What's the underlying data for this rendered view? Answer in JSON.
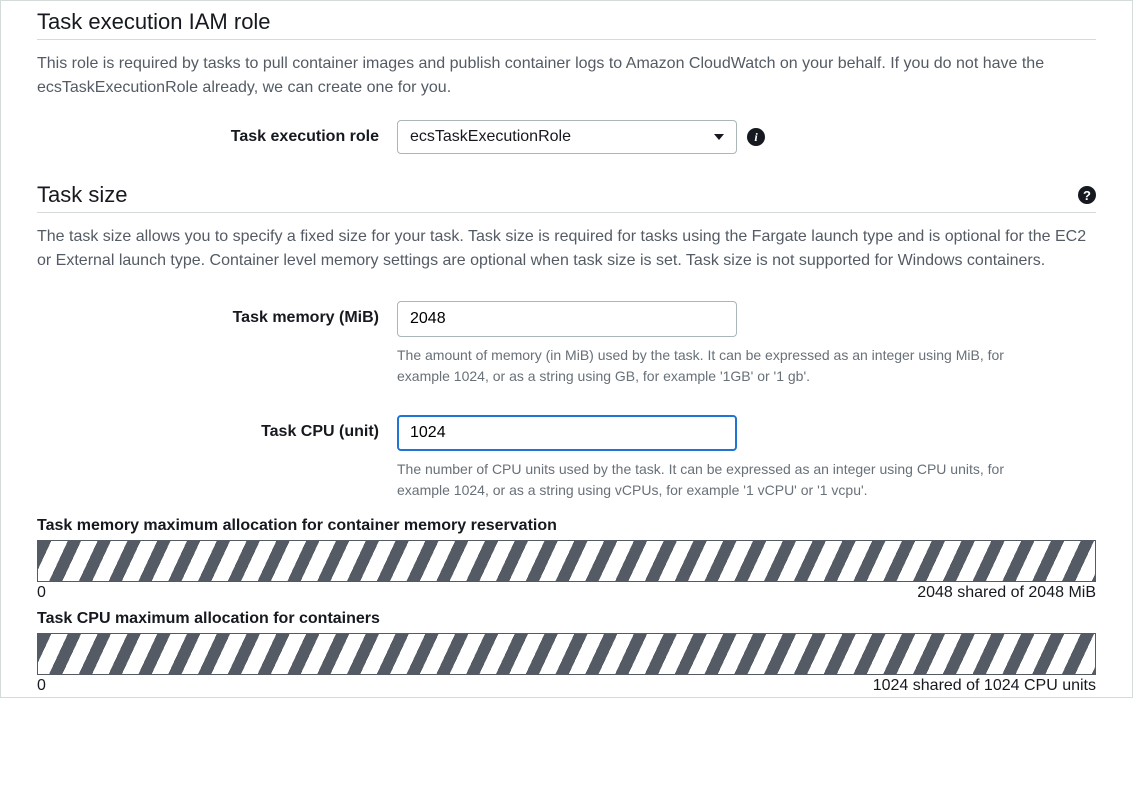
{
  "iam": {
    "title": "Task execution IAM role",
    "description": "This role is required by tasks to pull container images and publish container logs to Amazon CloudWatch on your behalf. If you do not have the ecsTaskExecutionRole already, we can create one for you.",
    "role_label": "Task execution role",
    "role_value": "ecsTaskExecutionRole"
  },
  "tasksize": {
    "title": "Task size",
    "description": "The task size allows you to specify a fixed size for your task. Task size is required for tasks using the Fargate launch type and is optional for the EC2 or External launch type. Container level memory settings are optional when task size is set. Task size is not supported for Windows containers.",
    "memory_label": "Task memory (MiB)",
    "memory_value": "2048",
    "memory_help": "The amount of memory (in MiB) used by the task. It can be expressed as an integer using MiB, for example 1024, or as a string using GB, for example '1GB' or '1 gb'.",
    "cpu_label": "Task CPU (unit)",
    "cpu_value": "1024",
    "cpu_help": "The number of CPU units used by the task. It can be expressed as an integer using CPU units, for example 1024, or as a string using vCPUs, for example '1 vCPU' or '1 vcpu'."
  },
  "alloc": {
    "mem_label": "Task memory maximum allocation for container memory reservation",
    "mem_min": "0",
    "mem_status": "2048 shared of 2048 MiB",
    "cpu_label": "Task CPU maximum allocation for containers",
    "cpu_min": "0",
    "cpu_status": "1024 shared of 1024 CPU units"
  }
}
